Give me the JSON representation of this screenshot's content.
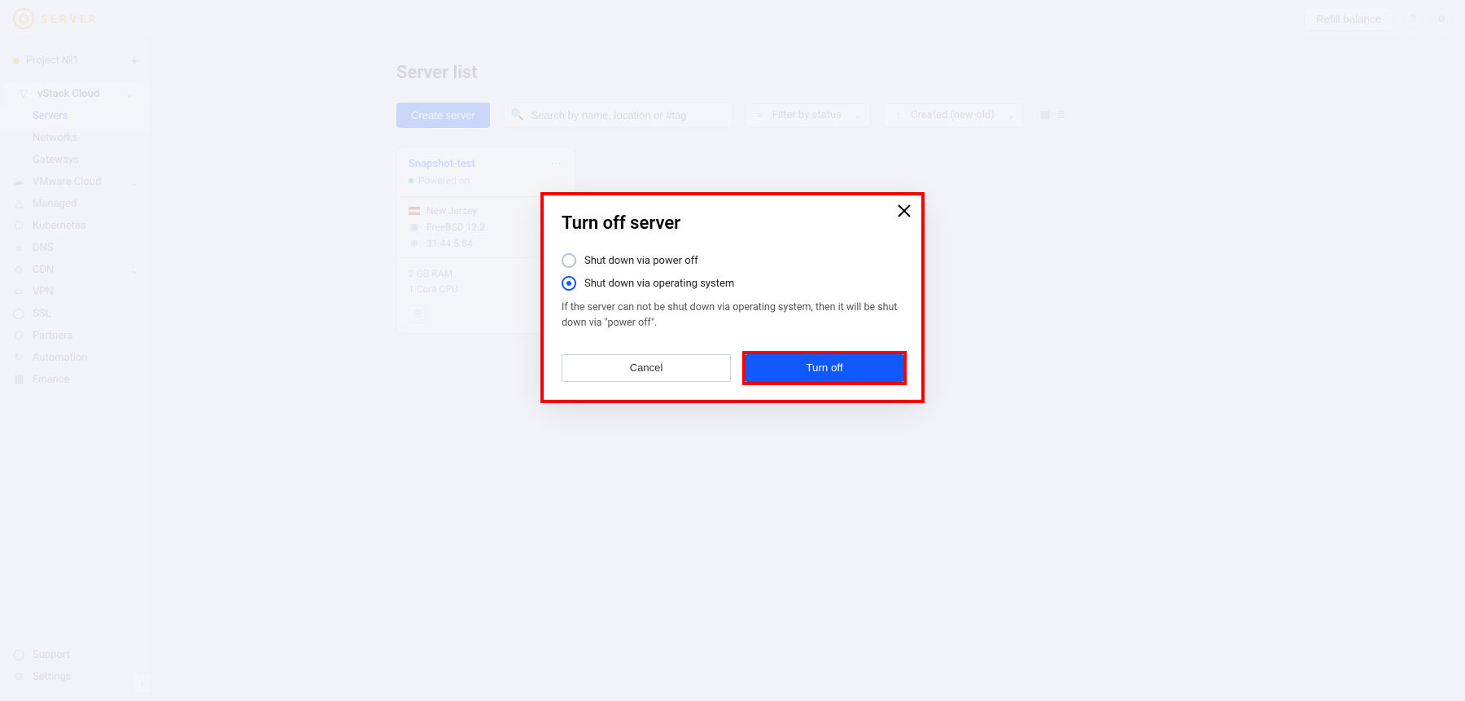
{
  "brand": {
    "line1": "SERVER",
    "line2": ""
  },
  "topbar": {
    "refill": "Refill balance",
    "avatar1": "?",
    "avatar2": "D"
  },
  "project": {
    "name": "Project №1"
  },
  "sidebar": {
    "groups": [
      {
        "label": "vStack Cloud",
        "expanded": true,
        "items": [
          "Servers",
          "Networks",
          "Gateways"
        ],
        "active": 0
      },
      {
        "label": "VMware Cloud",
        "expandable": true
      },
      {
        "label": "Managed"
      },
      {
        "label": "Kubernetes"
      },
      {
        "label": "DNS"
      },
      {
        "label": "CDN",
        "expandable": true
      },
      {
        "label": "VPN"
      },
      {
        "label": "SSL"
      },
      {
        "label": "Partners"
      },
      {
        "label": "Automation"
      },
      {
        "label": "Finance"
      }
    ],
    "bottom": [
      "Support",
      "Settings"
    ]
  },
  "page": {
    "title": "Server list"
  },
  "toolbar": {
    "create": "Create server",
    "search_placeholder": "Search by name, location or #tag",
    "filter_label": "Filter by status",
    "sort_label": "Created (new-old)"
  },
  "card": {
    "title": "Snapshot-test",
    "status": "Powered on",
    "location": "New Jersey",
    "os": "FreeBSD 12.2",
    "ip": "31.44.5.84",
    "ram": "2 GB RAM",
    "cpu": "1 Core CPU"
  },
  "modal": {
    "title": "Turn off server",
    "option1": "Shut down via power off",
    "option2": "Shut down via operating system",
    "selected": 1,
    "note": "If the server can not be shut down via operating system, then it will be shut down via \"power off\".",
    "cancel": "Cancel",
    "confirm": "Turn off"
  }
}
